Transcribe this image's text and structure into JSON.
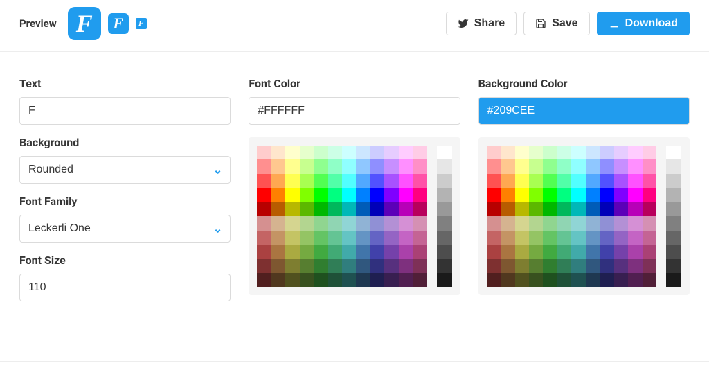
{
  "topbar": {
    "preview_label": "Preview",
    "share_label": "Share",
    "save_label": "Save",
    "download_label": "Download",
    "icon_letter": "F"
  },
  "left": {
    "text_label": "Text",
    "text_value": "F",
    "background_label": "Background",
    "background_value": "Rounded",
    "font_family_label": "Font Family",
    "font_family_value": "Leckerli One",
    "font_size_label": "Font Size",
    "font_size_value": "110"
  },
  "font_color": {
    "label": "Font Color",
    "value": "#FFFFFF"
  },
  "bg_color": {
    "label": "Background Color",
    "value": "#209CEE"
  },
  "palette": {
    "hues": [
      0,
      30,
      60,
      90,
      120,
      150,
      180,
      210,
      240,
      270,
      300,
      330
    ],
    "rows_light": [
      90,
      78,
      66,
      50,
      36
    ],
    "rows_muted_sat": 45,
    "rows_muted": [
      70,
      58,
      46,
      34,
      22
    ],
    "grays": [
      "#ffffff",
      "#e6e6e6",
      "#cccccc",
      "#b3b3b3",
      "#999999",
      "#808080",
      "#666666",
      "#4d4d4d",
      "#333333",
      "#1a1a1a"
    ]
  }
}
